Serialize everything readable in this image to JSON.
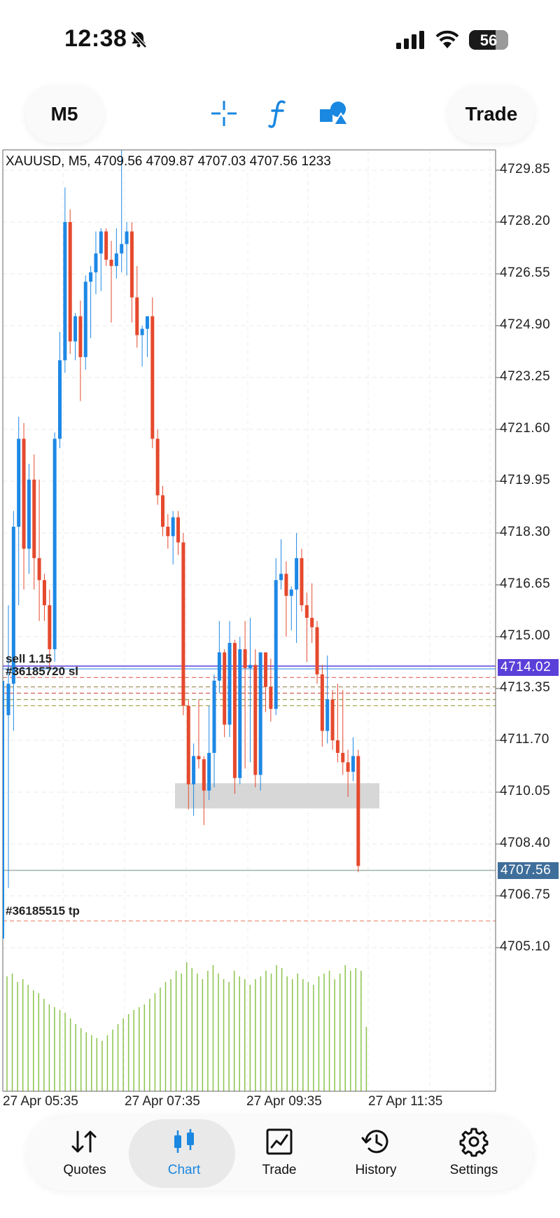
{
  "status": {
    "time": "12:38",
    "battery": "56"
  },
  "toolbar": {
    "timeframe": "M5",
    "trade_label": "Trade"
  },
  "chart_info": "XAUUSD, M5, 4709.56 4709.87 4707.03 4707.56 1233",
  "price_axis": [
    "4729.85",
    "4728.20",
    "4726.55",
    "4724.90",
    "4723.25",
    "4721.60",
    "4719.95",
    "4718.30",
    "4716.65",
    "4715.00",
    "4713.35",
    "4711.70",
    "4710.05",
    "4708.40",
    "4706.75",
    "4705.10"
  ],
  "price_tags": {
    "line_price": "4714.02",
    "current_price": "4707.56"
  },
  "time_axis": [
    "27 Apr 05:35",
    "27 Apr 07:35",
    "27 Apr 09:35",
    "27 Apr 11:35"
  ],
  "orders": {
    "sell_label": "sell 1.15",
    "sl_label": "#36185720 sl",
    "tp_label": "#36185515 tp"
  },
  "colors": {
    "bull": "#1e88e5",
    "bear": "#e5492d",
    "volume": "#8bc34a",
    "accent": "#1a87e0",
    "tag_purple": "#5b3fd9",
    "tag_current": "#3f6e9a"
  },
  "nav": [
    {
      "label": "Quotes",
      "icon": "quotes-arrows-icon"
    },
    {
      "label": "Chart",
      "icon": "candlestick-icon"
    },
    {
      "label": "Trade",
      "icon": "trade-chart-icon"
    },
    {
      "label": "History",
      "icon": "history-clock-icon"
    },
    {
      "label": "Settings",
      "icon": "gear-icon"
    }
  ],
  "chart_data": {
    "type": "candlestick",
    "symbol": "XAUUSD",
    "timeframe": "M5",
    "ylim": [
      4704.5,
      4731.0
    ],
    "x_labels": [
      "27 Apr 05:35",
      "27 Apr 07:35",
      "27 Apr 09:35",
      "27 Apr 11:35"
    ],
    "candles": [
      [
        4712.5,
        4716.0,
        4707.0,
        4713.5
      ],
      [
        4713.5,
        4719.0,
        4712.0,
        4718.5
      ],
      [
        4718.5,
        4722.0,
        4716.0,
        4721.3
      ],
      [
        4721.3,
        4721.8,
        4716.5,
        4717.8
      ],
      [
        4717.8,
        4720.5,
        4717.0,
        4720.0
      ],
      [
        4720.0,
        4720.8,
        4716.5,
        4717.5
      ],
      [
        4717.5,
        4720.0,
        4715.5,
        4716.8
      ],
      [
        4716.8,
        4717.0,
        4715.5,
        4716.0
      ],
      [
        4716.0,
        4716.5,
        4714.0,
        4714.6
      ],
      [
        4714.6,
        4721.5,
        4714.2,
        4721.3
      ],
      [
        4721.3,
        4724.7,
        4721.0,
        4723.8
      ],
      [
        4723.8,
        4729.3,
        4723.4,
        4728.2
      ],
      [
        4728.2,
        4728.6,
        4724.0,
        4724.4
      ],
      [
        4724.4,
        4725.3,
        4723.8,
        4725.2
      ],
      [
        4725.2,
        4725.7,
        4722.5,
        4723.9
      ],
      [
        4723.9,
        4726.5,
        4723.5,
        4726.3
      ],
      [
        4726.3,
        4726.8,
        4724.5,
        4726.6
      ],
      [
        4726.6,
        4727.9,
        4725.9,
        4727.2
      ],
      [
        4727.2,
        4728.0,
        4726.0,
        4727.9
      ],
      [
        4727.9,
        4728.0,
        4726.8,
        4727.0
      ],
      [
        4727.0,
        4727.6,
        4725.0,
        4726.8
      ],
      [
        4726.8,
        4728.0,
        4726.4,
        4727.2
      ],
      [
        4727.2,
        4730.5,
        4726.6,
        4727.5
      ],
      [
        4727.5,
        4728.2,
        4726.5,
        4727.9
      ],
      [
        4727.9,
        4728.2,
        4725.0,
        4725.8
      ],
      [
        4725.8,
        4726.8,
        4724.2,
        4724.6
      ],
      [
        4724.6,
        4724.9,
        4723.6,
        4724.8
      ],
      [
        4724.8,
        4725.1,
        4723.9,
        4725.2
      ],
      [
        4725.2,
        4725.8,
        4721.0,
        4721.3
      ],
      [
        4721.3,
        4721.6,
        4719.2,
        4719.5
      ],
      [
        4719.5,
        4719.8,
        4718.2,
        4718.5
      ],
      [
        4718.5,
        4718.9,
        4717.8,
        4718.2
      ],
      [
        4718.2,
        4719.0,
        4717.3,
        4718.8
      ],
      [
        4718.8,
        4719.0,
        4717.6,
        4718.0
      ],
      [
        4718.0,
        4718.3,
        4712.5,
        4712.8
      ],
      [
        4712.8,
        4713.0,
        4709.5,
        4710.3
      ],
      [
        4710.3,
        4711.6,
        4709.3,
        4711.2
      ],
      [
        4711.2,
        4713.0,
        4710.8,
        4711.1
      ],
      [
        4711.1,
        4711.2,
        4709.0,
        4710.1
      ],
      [
        4710.1,
        4712.8,
        4709.8,
        4711.3
      ],
      [
        4711.3,
        4713.8,
        4710.2,
        4713.6
      ],
      [
        4713.6,
        4715.5,
        4713.2,
        4714.5
      ],
      [
        4714.5,
        4714.6,
        4711.8,
        4712.2
      ],
      [
        4712.2,
        4715.5,
        4711.8,
        4714.8
      ],
      [
        4714.8,
        4714.9,
        4710.0,
        4710.5
      ],
      [
        4710.5,
        4715.0,
        4710.3,
        4714.6
      ],
      [
        4714.6,
        4715.5,
        4710.8,
        4714.0
      ],
      [
        4714.0,
        4715.6,
        4711.0,
        4714.1
      ],
      [
        4714.1,
        4714.6,
        4710.2,
        4710.6
      ],
      [
        4710.6,
        4712.0,
        4710.1,
        4714.5
      ],
      [
        4714.5,
        4713.5,
        4712.6,
        4713.4
      ],
      [
        4713.4,
        4714.3,
        4712.3,
        4712.7
      ],
      [
        4712.7,
        4717.5,
        4712.5,
        4716.8
      ],
      [
        4716.8,
        4718.1,
        4716.5,
        4717.0
      ],
      [
        4717.0,
        4717.4,
        4715.0,
        4716.3
      ],
      [
        4716.3,
        4716.6,
        4715.2,
        4716.5
      ],
      [
        4716.5,
        4718.3,
        4714.8,
        4717.5
      ],
      [
        4717.5,
        4717.8,
        4715.8,
        4716.0
      ],
      [
        4716.0,
        4716.4,
        4714.2,
        4715.6
      ],
      [
        4715.6,
        4716.7,
        4714.8,
        4715.3
      ],
      [
        4715.3,
        4715.5,
        4713.5,
        4713.8
      ],
      [
        4713.8,
        4714.1,
        4711.5,
        4712.0
      ],
      [
        4712.0,
        4714.4,
        4711.6,
        4713.0
      ],
      [
        4713.0,
        4713.3,
        4711.4,
        4711.7
      ],
      [
        4711.7,
        4713.5,
        4711.0,
        4711.3
      ],
      [
        4711.3,
        4713.3,
        4710.6,
        4711.0
      ],
      [
        4711.0,
        4711.4,
        4709.9,
        4710.7
      ],
      [
        4710.7,
        4711.8,
        4710.4,
        4711.2
      ],
      [
        4711.2,
        4711.4,
        4707.5,
        4707.7
      ]
    ],
    "volumes": [
      0.82,
      0.84,
      0.78,
      0.8,
      0.76,
      0.72,
      0.7,
      0.66,
      0.62,
      0.6,
      0.58,
      0.56,
      0.52,
      0.48,
      0.45,
      0.42,
      0.4,
      0.38,
      0.36,
      0.4,
      0.44,
      0.48,
      0.52,
      0.55,
      0.58,
      0.6,
      0.62,
      0.66,
      0.7,
      0.74,
      0.78,
      0.8,
      0.86,
      0.84,
      0.92,
      0.88,
      0.84,
      0.8,
      0.86,
      0.9,
      0.84,
      0.8,
      0.78,
      0.86,
      0.82,
      0.8,
      0.76,
      0.8,
      0.82,
      0.86,
      0.84,
      0.9,
      0.88,
      0.82,
      0.8,
      0.84,
      0.8,
      0.78,
      0.76,
      0.82,
      0.84,
      0.86,
      0.8,
      0.84,
      0.9,
      0.86,
      0.88,
      0.86,
      0.46
    ],
    "horizontal_lines": {
      "sell_line": 4714.02,
      "sl_levels": [
        4713.7,
        4713.4,
        4713.2,
        4713.0,
        4712.8
      ],
      "tp_level": 4705.95,
      "current": 4707.56
    },
    "zone": {
      "from": 4709.6,
      "to": 4710.2
    }
  }
}
